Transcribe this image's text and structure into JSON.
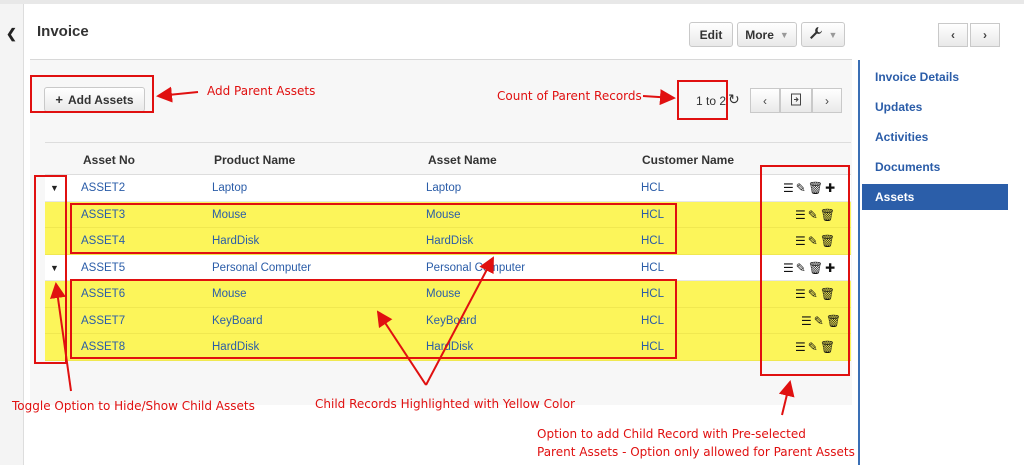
{
  "header": {
    "title": "Invoice",
    "edit_label": "Edit",
    "more_label": "More",
    "collapse_glyph": "❮",
    "prev_glyph": "‹",
    "next_glyph": "›"
  },
  "toolbar": {
    "add_assets_label": "Add Assets",
    "pager_text": "1 to 2"
  },
  "grid": {
    "columns": [
      "Asset No",
      "Product Name",
      "Asset Name",
      "Customer Name"
    ],
    "rows": [
      {
        "type": "parent",
        "asset_no": "ASSET2",
        "product": "Laptop",
        "asset_name": "Laptop",
        "customer": "HCL"
      },
      {
        "type": "child",
        "asset_no": "ASSET3",
        "product": "Mouse",
        "asset_name": "Mouse",
        "customer": "HCL"
      },
      {
        "type": "child",
        "asset_no": "ASSET4",
        "product": "HardDisk",
        "asset_name": "HardDisk",
        "customer": "HCL"
      },
      {
        "type": "parent",
        "asset_no": "ASSET5",
        "product": "Personal Computer",
        "asset_name": "Personal Computer",
        "customer": "HCL"
      },
      {
        "type": "child",
        "asset_no": "ASSET6",
        "product": "Mouse",
        "asset_name": "Mouse",
        "customer": "HCL"
      },
      {
        "type": "child",
        "asset_no": "ASSET7",
        "product": "KeyBoard",
        "asset_name": "KeyBoard",
        "customer": "HCL"
      },
      {
        "type": "child",
        "asset_no": "ASSET8",
        "product": "HardDisk",
        "asset_name": "HardDisk",
        "customer": "HCL"
      }
    ]
  },
  "sidebar": {
    "items": [
      {
        "label": "Invoice Details",
        "active": false
      },
      {
        "label": "Updates",
        "active": false
      },
      {
        "label": "Activities",
        "active": false
      },
      {
        "label": "Documents",
        "active": false
      },
      {
        "label": "Assets",
        "active": true
      }
    ]
  },
  "annotations": {
    "add_parent": "Add Parent Assets",
    "count_parent": "Count of Parent Records",
    "toggle_option": "Toggle Option to Hide/Show Child Assets",
    "child_highlight": "Child Records Highlighted with Yellow Color",
    "child_option_line1": "Option to add Child Record with Pre-selected",
    "child_option_line2": "Parent Assets - Option only allowed for Parent Assets"
  },
  "colors": {
    "accent": "#2b5ea9",
    "child_row": "#fcf55a",
    "annotation": "#e01010"
  }
}
